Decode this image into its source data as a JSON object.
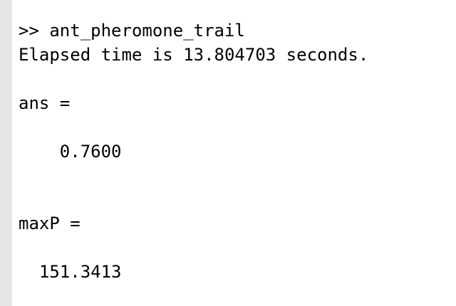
{
  "console": {
    "lines": [
      ">> ant_pheromone_trail",
      "Elapsed time is 13.804703 seconds.",
      "ans =",
      "    0.7600",
      "maxP =",
      "  151.3413"
    ]
  }
}
